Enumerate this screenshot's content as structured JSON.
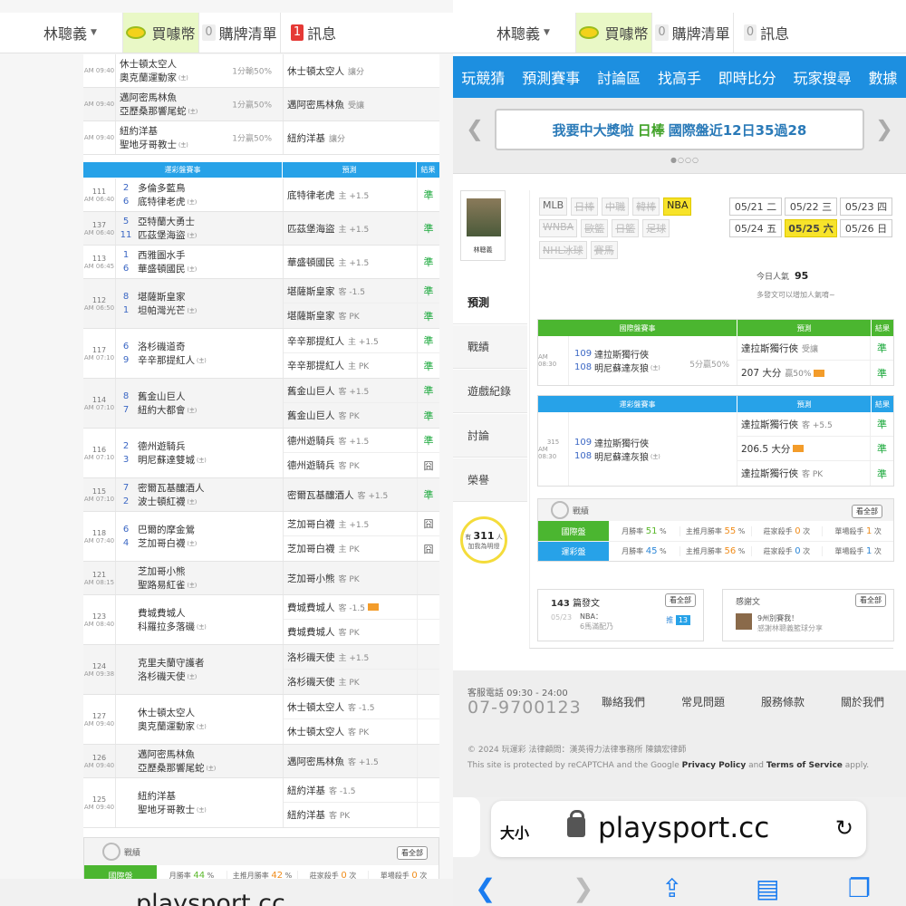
{
  "topbar": {
    "user": "林聰義",
    "coin": "買噱幣",
    "cart_count": "0",
    "cart": "購牌清單",
    "msg_count": "1",
    "msg_count_r": "0",
    "msg": "訊息"
  },
  "left": {
    "top_groups": [
      {
        "time": "AM 09:40",
        "teams": [
          "休士頓太空人",
          "奧克蘭運動家"
        ],
        "odds": "1分輸50%",
        "pick": "休士頓太空人",
        "sub": "讓分"
      },
      {
        "time": "AM 09:40",
        "teams": [
          "邁阿密馬林魚",
          "亞歷桑那響尾蛇"
        ],
        "odds": "1分贏50%",
        "pick": "邁阿密馬林魚",
        "sub": "受讓"
      },
      {
        "time": "AM 09:40",
        "teams": [
          "紐約洋基",
          "聖地牙哥教士"
        ],
        "odds": "1分贏50%",
        "pick": "紐約洋基",
        "sub": "讓分"
      }
    ],
    "header": {
      "game": "運彩盤賽事",
      "pred": "預測",
      "res": "結果"
    },
    "groups": [
      {
        "id": "111",
        "time": "AM 06:40",
        "n1": "2",
        "t1": "多倫多藍鳥",
        "n2": "6",
        "t2": "底特律老虎",
        "picks": [
          {
            "t": "底特律老虎",
            "s": "主 +1.5",
            "r": "準"
          }
        ]
      },
      {
        "id": "137",
        "time": "AM 06:40",
        "n1": "5",
        "t1": "亞特蘭大勇士",
        "n2": "11",
        "t2": "匹茲堡海盜",
        "picks": [
          {
            "t": "匹茲堡海盜",
            "s": "主 +1.5",
            "r": "準"
          }
        ]
      },
      {
        "id": "113",
        "time": "AM 06:45",
        "n1": "1",
        "t1": "西雅圖水手",
        "n2": "6",
        "t2": "華盛頓國民",
        "picks": [
          {
            "t": "華盛頓國民",
            "s": "主 +1.5",
            "r": "準"
          }
        ]
      },
      {
        "id": "112",
        "time": "AM 06:50",
        "n1": "8",
        "t1": "堪薩斯皇家",
        "n2": "1",
        "t2": "坦帕灣光芒",
        "picks": [
          {
            "t": "堪薩斯皇家",
            "s": "客 -1.5",
            "r": "準"
          },
          {
            "t": "堪薩斯皇家",
            "s": "客 PK",
            "r": "準"
          }
        ]
      },
      {
        "id": "117",
        "time": "AM 07:10",
        "n1": "6",
        "t1": "洛杉磯道奇",
        "n2": "9",
        "t2": "辛辛那提紅人",
        "picks": [
          {
            "t": "辛辛那提紅人",
            "s": "主 +1.5",
            "r": "準"
          },
          {
            "t": "辛辛那提紅人",
            "s": "主 PK",
            "r": "準"
          }
        ]
      },
      {
        "id": "114",
        "time": "AM 07:10",
        "n1": "8",
        "t1": "舊金山巨人",
        "n2": "7",
        "t2": "紐約大都會",
        "picks": [
          {
            "t": "舊金山巨人",
            "s": "客 +1.5",
            "r": "準"
          },
          {
            "t": "舊金山巨人",
            "s": "客 PK",
            "r": "準"
          }
        ]
      },
      {
        "id": "116",
        "time": "AM 07:10",
        "n1": "2",
        "t1": "德州遊騎兵",
        "n2": "3",
        "t2": "明尼蘇達雙城",
        "picks": [
          {
            "t": "德州遊騎兵",
            "s": "客 +1.5",
            "r": "準"
          },
          {
            "t": "德州遊騎兵",
            "s": "客 PK",
            "r": "囧"
          }
        ]
      },
      {
        "id": "115",
        "time": "AM 07:10",
        "n1": "7",
        "t1": "密爾瓦基釀酒人",
        "n2": "2",
        "t2": "波士頓紅襪",
        "picks": [
          {
            "t": "密爾瓦基釀酒人",
            "s": "客 +1.5",
            "r": "準"
          }
        ]
      },
      {
        "id": "118",
        "time": "AM 07:40",
        "n1": "6",
        "t1": "巴爾的摩金鶯",
        "n2": "4",
        "t2": "芝加哥白襪",
        "picks": [
          {
            "t": "芝加哥白襪",
            "s": "主 +1.5",
            "r": "囧"
          },
          {
            "t": "芝加哥白襪",
            "s": "主 PK",
            "r": "囧"
          }
        ]
      },
      {
        "id": "121",
        "time": "AM 08:15",
        "n1": "",
        "t1": "芝加哥小熊",
        "n2": "",
        "t2": "聖路易紅雀",
        "picks": [
          {
            "t": "芝加哥小熊",
            "s": "客 PK",
            "r": ""
          }
        ]
      },
      {
        "id": "123",
        "time": "AM 08:40",
        "n1": "",
        "t1": "費城費城人",
        "n2": "",
        "t2": "科羅拉多落磯",
        "picks": [
          {
            "t": "費城費城人",
            "s": "客 -1.5",
            "r": ""
          },
          {
            "t": "費城費城人",
            "s": "客 PK",
            "r": ""
          }
        ]
      },
      {
        "id": "124",
        "time": "AM 09:38",
        "n1": "",
        "t1": "克里夫蘭守護者",
        "n2": "",
        "t2": "洛杉磯天使",
        "picks": [
          {
            "t": "洛杉磯天使",
            "s": "主 +1.5",
            "r": ""
          },
          {
            "t": "洛杉磯天使",
            "s": "主 PK",
            "r": ""
          }
        ]
      },
      {
        "id": "127",
        "time": "AM 09:40",
        "n1": "",
        "t1": "休士頓太空人",
        "n2": "",
        "t2": "奧克蘭運動家",
        "picks": [
          {
            "t": "休士頓太空人",
            "s": "客 -1.5",
            "r": ""
          },
          {
            "t": "休士頓太空人",
            "s": "客 PK",
            "r": ""
          }
        ]
      },
      {
        "id": "126",
        "time": "AM 09:40",
        "n1": "",
        "t1": "邁阿密馬林魚",
        "n2": "",
        "t2": "亞歷桑那響尾蛇",
        "picks": [
          {
            "t": "邁阿密馬林魚",
            "s": "客 +1.5",
            "r": ""
          }
        ]
      },
      {
        "id": "125",
        "time": "AM 09:40",
        "n1": "",
        "t1": "紐約洋基",
        "n2": "",
        "t2": "聖地牙哥教士",
        "picks": [
          {
            "t": "紐約洋基",
            "s": "客 -1.5",
            "r": ""
          },
          {
            "t": "紐約洋基",
            "s": "客 PK",
            "r": ""
          }
        ]
      }
    ],
    "stats": {
      "title": "戰績",
      "btn": "看全部",
      "label": "國際盤",
      "c1": "月勝率",
      "v1": "44",
      "c2": "主推月勝率",
      "v2": "42",
      "c3": "莊家殺手",
      "v3": "0",
      "c4": "單場殺手",
      "v4": "0",
      "unit_pct": "%",
      "unit_cnt": "次"
    },
    "url": "playsport.cc"
  },
  "right": {
    "nav": [
      "玩競猜",
      "預測賽事",
      "討論區",
      "找高手",
      "即時比分",
      "玩家搜尋",
      "數據"
    ],
    "banner": {
      "a": "我要中大獎啦",
      "b": "日棒",
      "c": "國際盤近12日35過28"
    },
    "user_name": "林聰義",
    "tabs": [
      "預測",
      "戰績",
      "遊戲紀錄",
      "討論",
      "榮譽"
    ],
    "bulb": {
      "pre": "有",
      "num": "311",
      "post": "人",
      "sub": "加我為明燈"
    },
    "leagues": [
      "MLB",
      "日棒",
      "中職",
      "韓棒",
      "NBA",
      "WNBA",
      "歐籃",
      "日籃",
      "足球",
      "NHL冰球",
      "賽馬"
    ],
    "dates": [
      "05/21 二",
      "05/22 三",
      "05/23 四",
      "05/24 五",
      "05/25 六",
      "05/26 日"
    ],
    "pop_label": "今日人氣",
    "pop_val": "95",
    "pop_note": "多發文可以增加人氣唷~",
    "intl": {
      "header": "國際盤賽事",
      "pred": "預測",
      "res": "結果",
      "time": "AM 08:30",
      "n1": "109",
      "t1": "達拉斯獨行俠",
      "n2": "108",
      "t2": "明尼蘇達灰狼",
      "odds": "5分贏50%",
      "p1": "達拉斯獨行俠",
      "s1": "受讓",
      "r1": "準",
      "p2": "207 大分",
      "s2": "贏50%",
      "r2": "準"
    },
    "lottery": {
      "header": "運彩盤賽事",
      "pred": "預測",
      "res": "結果",
      "id": "315",
      "time": "AM 08:30",
      "n1": "109",
      "t1": "達拉斯獨行俠",
      "n2": "108",
      "t2": "明尼蘇達灰狼",
      "p1": "達拉斯獨行俠",
      "s1": "客 +5.5",
      "r1": "準",
      "p2": "206.5 大分",
      "r2": "準",
      "p3": "達拉斯獨行俠",
      "s3": "客 PK",
      "r3": "準"
    },
    "stats": {
      "title": "戰績",
      "btn": "看全部",
      "l1": "國際盤",
      "v1a": "51",
      "v1b": "55",
      "v1c": "0",
      "v1d": "1",
      "l2": "運彩盤",
      "v2a": "45",
      "v2b": "56",
      "v2c": "0",
      "v2d": "1",
      "c1": "月勝率",
      "c2": "主推月勝率",
      "c3": "莊家殺手",
      "c4": "單場殺手",
      "unit_pct": "%",
      "unit_cnt": "次"
    },
    "posts": {
      "count": "143",
      "label": "篇發文",
      "btn": "看全部",
      "d1": "05",
      "d2": "23",
      "tag": "NBA：",
      "txt": "6馬滿配乃",
      "badge_l": "推",
      "badge": "13"
    },
    "fans": {
      "label": "感謝文",
      "btn": "看全部",
      "txt1": "9州別賽我！",
      "txt2": "感謝林聰義籃球分享"
    },
    "foot": {
      "phone_label": "客服電話 09:30 - 24:00",
      "phone": "07-9700123",
      "links": [
        "聯絡我們",
        "常見問題",
        "服務條款",
        "關於我們"
      ],
      "copy": "© 2024 玩運彩 法律顧問：漢英得力法律事務所 陳鎮宏律師",
      "rc1": "This site is protected by reCAPTCHA and the Google ",
      "rc2": "Privacy Policy",
      "rc3": " and ",
      "rc4": "Terms of Service",
      "rc5": " apply."
    },
    "safari": {
      "aa": "大小",
      "url": "playsport.cc"
    }
  }
}
